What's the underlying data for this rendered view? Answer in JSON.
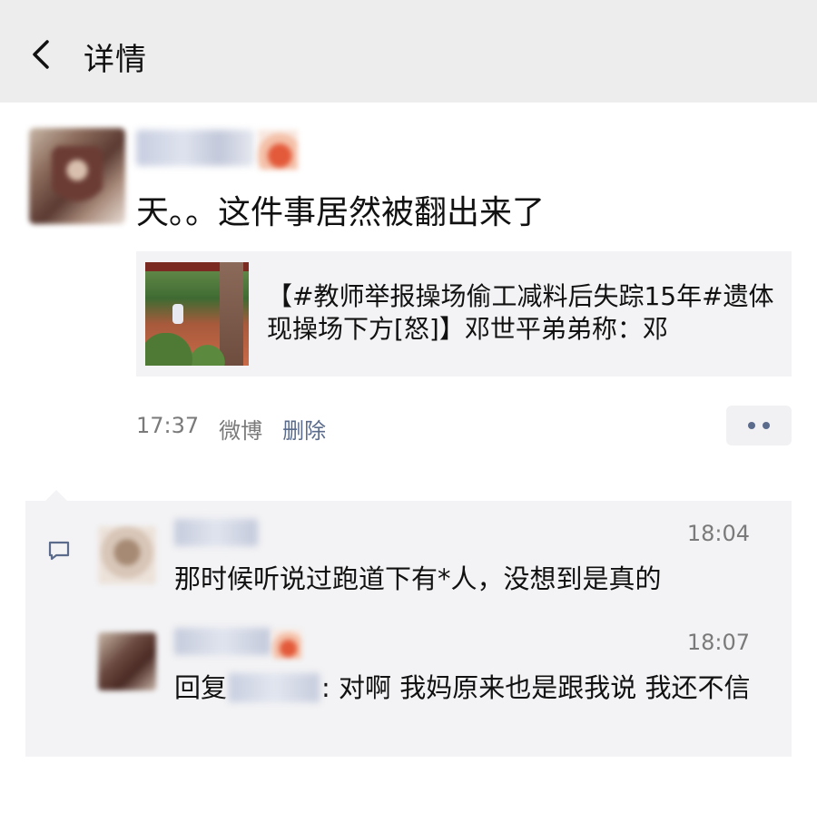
{
  "navbar": {
    "title": "详情",
    "back_icon": "chevron-left-icon"
  },
  "post": {
    "text": "天。。这件事居然被翻出来了",
    "link": {
      "text": "【#教师举报操场偷工减料后失踪15年#遗体现操场下方[怒]】邓世平弟弟称：邓"
    },
    "meta": {
      "time": "17:37",
      "source": "微博",
      "delete_label": "删除"
    },
    "more_icon": "more-dots-icon"
  },
  "comments": {
    "icon": "comment-icon",
    "items": [
      {
        "time": "18:04",
        "text": "那时候听说过跑道下有*人，没想到是真的"
      },
      {
        "time": "18:07",
        "reply_prefix": "回复",
        "text": ": 对啊 我妈原来也是跟我说 我还不信"
      }
    ]
  },
  "colors": {
    "navbar_bg": "#ededed",
    "link_blue": "#5b6b8c",
    "card_bg": "#f3f3f5",
    "meta_gray": "#7a7a7a"
  }
}
